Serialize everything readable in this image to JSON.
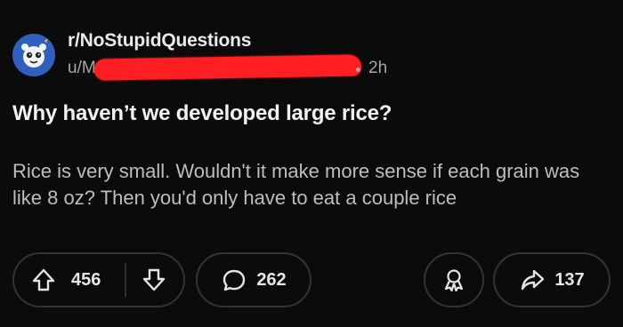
{
  "subreddit": {
    "name": "r/NoStupidQuestions"
  },
  "author": {
    "prefix": "u/Mysteric",
    "time": "2h"
  },
  "post": {
    "title": "Why haven’t we developed large rice?",
    "body": "Rice is very small. Wouldn't it make more sense if each grain was like 8 oz? Then you'd only have to eat a couple rice"
  },
  "actions": {
    "upvotes": "456",
    "comments": "262",
    "shares": "137"
  },
  "icons": [
    "avatar",
    "upvote-icon",
    "downvote-icon",
    "comment-icon",
    "award-icon",
    "share-icon"
  ]
}
